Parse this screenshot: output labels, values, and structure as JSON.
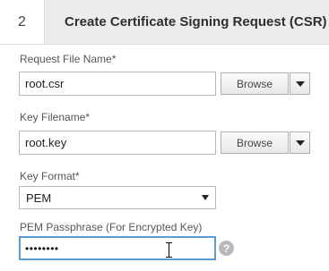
{
  "step": {
    "number": "2",
    "title": "Create Certificate Signing Request (CSR)"
  },
  "request_file": {
    "label": "Request File Name*",
    "value": "root.csr",
    "browse_label": "Browse"
  },
  "key_file": {
    "label": "Key Filename*",
    "value": "root.key",
    "browse_label": "Browse"
  },
  "key_format": {
    "label": "Key Format*",
    "selected": "PEM"
  },
  "pem_passphrase": {
    "label": "PEM Passphrase (For Encrypted Key)",
    "masked_value": "••••••••"
  },
  "help": {
    "glyph": "?"
  },
  "colors": {
    "header_bg": "#ececec",
    "focus_border": "#5b9bd5",
    "help_bg": "#b9b9b9"
  },
  "icons": [
    "dropdown-arrow-icon",
    "select-caret-icon",
    "text-cursor-icon",
    "help-icon"
  ]
}
